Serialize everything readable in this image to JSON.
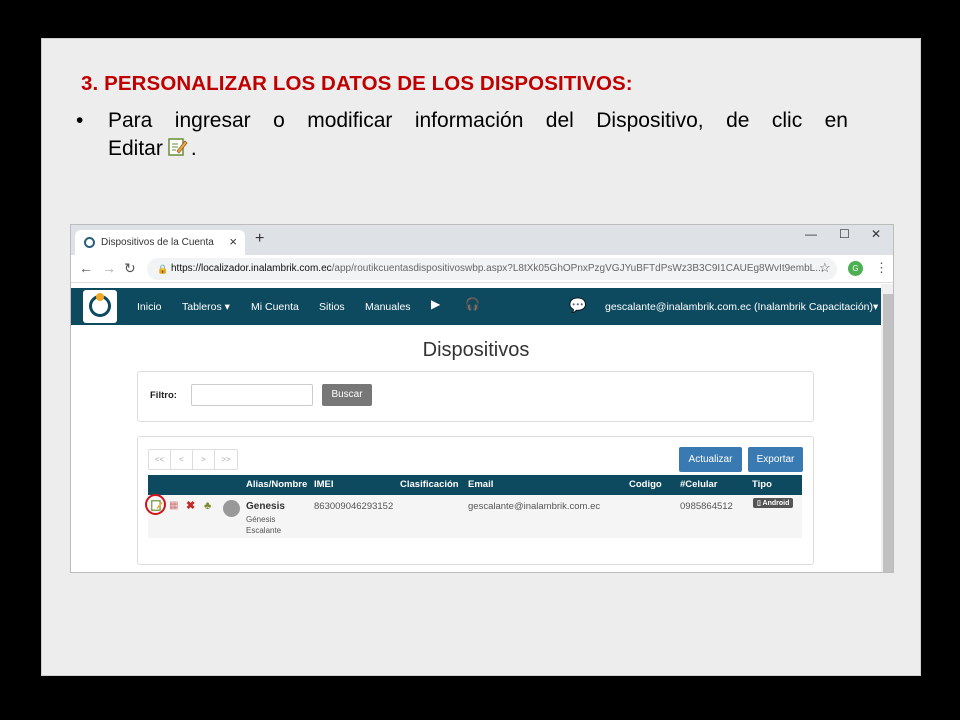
{
  "slide": {
    "title": "3. PERSONALIZAR LOS DATOS DE LOS DISPOSITIVOS:",
    "bullet_line1": "Para ingresar o modificar información del Dispositivo, de clic en",
    "bullet_line2": "Editar",
    "bullet_end": "."
  },
  "browser": {
    "tab_title": "Dispositivos de la Cuenta",
    "url_host": "https://localizador.inalambrik.com.ec",
    "url_path": "/app/routikcuentasdispositivoswbp.aspx?L8tXk05GhOPnxPzgVGJYuBFTdPsWz3B3C9I1CAUEg8WvIt9embL...",
    "profile_initial": "G"
  },
  "app": {
    "nav": [
      "Inicio",
      "Tableros ▾",
      "Mi Cuenta",
      "Sitios",
      "Manuales"
    ],
    "user": "gescalante@inalambrik.com.ec (Inalambrik Capacitación)▾",
    "page_title": "Dispositivos",
    "filter_label": "Filtro:",
    "search_label": "Buscar",
    "pager": [
      "<<",
      "<",
      ">",
      ">>"
    ],
    "refresh_label": "Actualizar",
    "export_label": "Exportar",
    "columns": [
      "Alias/Nombre",
      "IMEI",
      "Clasificación",
      "Email",
      "Codigo",
      "#Celular",
      "Tipo"
    ],
    "row": {
      "alias": "Genesis",
      "name1": "Génesis",
      "name2": "Escalante",
      "imei": "863009046293152",
      "email": "gescalante@inalambrik.com.ec",
      "phone": "0985864512",
      "type": "Android"
    }
  },
  "colors": {
    "title_red": "#c00000",
    "nav_teal": "#0e4a5f",
    "button_blue": "#3a7ab3"
  }
}
